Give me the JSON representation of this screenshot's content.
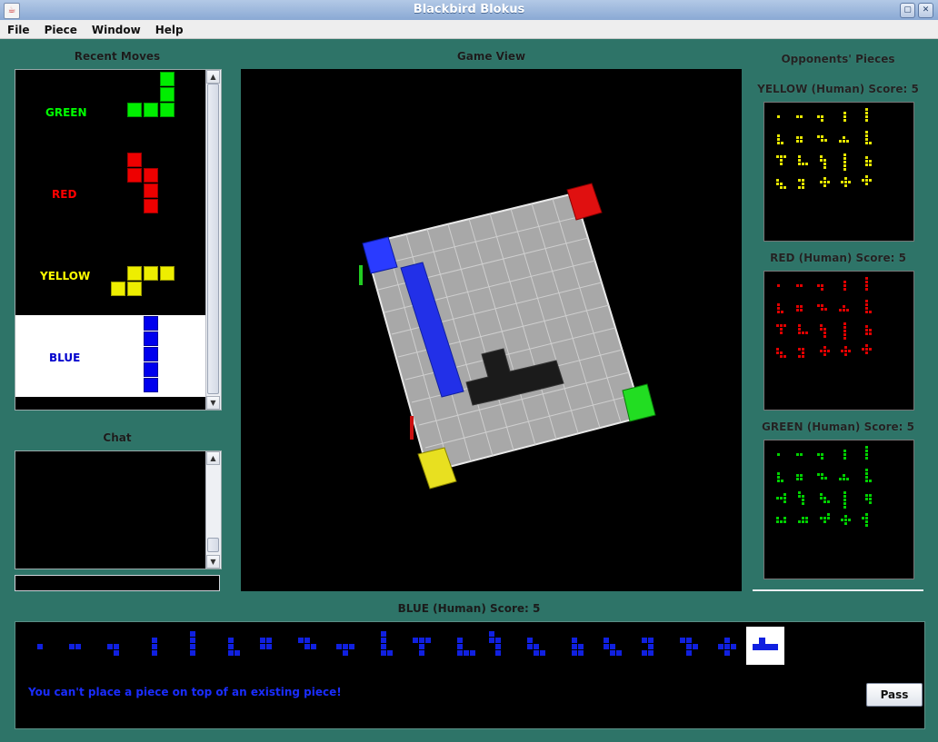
{
  "window": {
    "title": "Blackbird Blokus",
    "icon": "java-cup-icon"
  },
  "menu": [
    "File",
    "Piece",
    "Window",
    "Help"
  ],
  "labels": {
    "recent_moves": "Recent Moves",
    "chat": "Chat",
    "game_view": "Game View",
    "opponents": "Opponents' Pieces"
  },
  "recent_moves": [
    {
      "player": "GREEN",
      "color": "#00ff00",
      "bg": "#000000",
      "label_color": "#00ff00"
    },
    {
      "player": "RED",
      "color": "#ff0000",
      "bg": "#000000",
      "label_color": "#ff0000"
    },
    {
      "player": "YELLOW",
      "color": "#ffff00",
      "bg": "#000000",
      "label_color": "#ffff00"
    },
    {
      "player": "BLUE",
      "color": "#0000ff",
      "bg": "#ffffff",
      "label_color": "#0000cc"
    }
  ],
  "opponents": [
    {
      "title": "YELLOW (Human) Score: 5",
      "color": "#e6e600"
    },
    {
      "title": "RED (Human) Score: 5",
      "color": "#e60000"
    },
    {
      "title": "GREEN (Human) Score: 5",
      "color": "#00d400"
    }
  ],
  "player": {
    "title": "BLUE (Human) Score: 5",
    "message": "You can't place a piece on top of an existing piece!",
    "pass_label": "Pass",
    "color": "#0000ff"
  },
  "board": {
    "color_board": "#a8a8a8",
    "color_lines": "#dddddd",
    "color_black_piece": "#1a1a1a"
  }
}
